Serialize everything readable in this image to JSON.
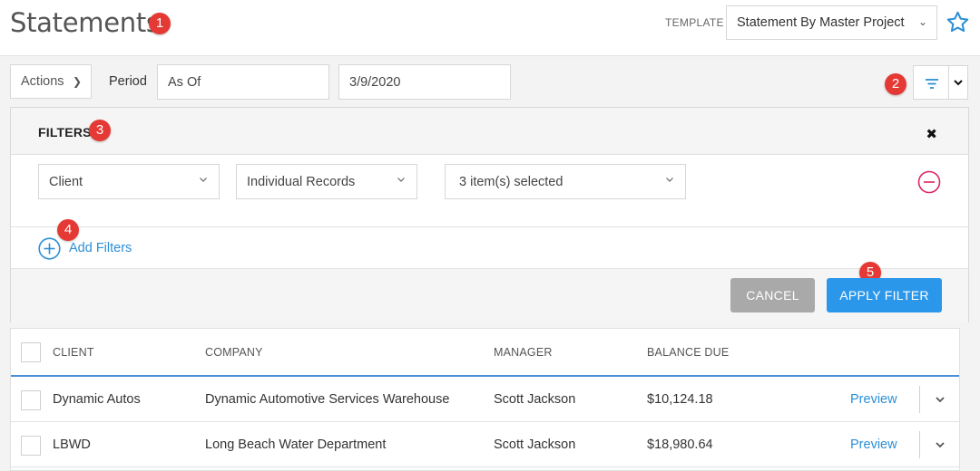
{
  "header": {
    "title": "Statements",
    "template_label": "TEMPLATE",
    "template_value": "Statement By Master Project"
  },
  "toolbar": {
    "actions_label": "Actions",
    "period_label": "Period",
    "period_value": "As Of",
    "date_value": "3/9/2020"
  },
  "filters": {
    "title": "FILTERS",
    "field": "Client",
    "mode": "Individual Records",
    "selection": "3 item(s) selected",
    "add_label": "Add Filters",
    "cancel_label": "CANCEL",
    "apply_label": "APPLY FILTER"
  },
  "badges": [
    "1",
    "2",
    "3",
    "4",
    "5"
  ],
  "table": {
    "columns": [
      "CLIENT",
      "COMPANY",
      "MANAGER",
      "BALANCE DUE"
    ],
    "rows": [
      {
        "client": "Dynamic Autos",
        "company": "Dynamic Automotive Services Warehouse",
        "manager": "Scott Jackson",
        "balance": "$10,124.18",
        "action": "Preview"
      },
      {
        "client": "LBWD",
        "company": "Long Beach Water Department",
        "manager": "Scott Jackson",
        "balance": "$18,980.64",
        "action": "Preview"
      }
    ]
  },
  "icons": [
    "star-icon",
    "filter-icon",
    "close-icon",
    "remove-circle-icon",
    "add-circle-icon",
    "chevron-down-icon"
  ],
  "colors": {
    "accent": "#2b97ea",
    "link": "#2b8fd6",
    "badge": "#e53935",
    "remove": "#e0245e"
  }
}
